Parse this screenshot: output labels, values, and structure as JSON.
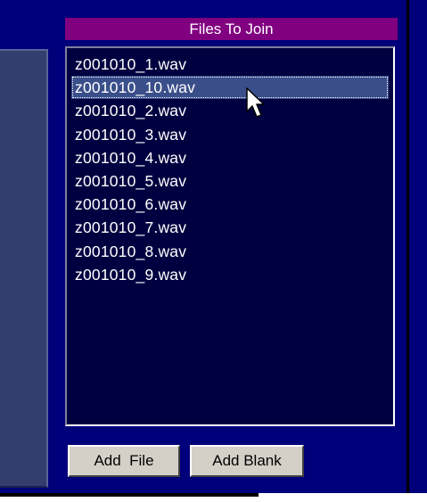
{
  "panel": {
    "title": "Files To Join"
  },
  "files": [
    "z001010_1.wav",
    "z001010_10.wav",
    "z001010_2.wav",
    "z001010_3.wav",
    "z001010_4.wav",
    "z001010_5.wav",
    "z001010_6.wav",
    "z001010_7.wav",
    "z001010_8.wav",
    "z001010_9.wav"
  ],
  "selected_index": 1,
  "buttons": {
    "add_file": "Add  File",
    "add_blank": "Add Blank"
  },
  "icons": {
    "cursor": "mouse-pointer-icon"
  },
  "colors": {
    "background": "#00007a",
    "header": "#800080",
    "list_background": "#000040",
    "selection": "#3a4f8a",
    "button_face": "#d4d0c8"
  }
}
